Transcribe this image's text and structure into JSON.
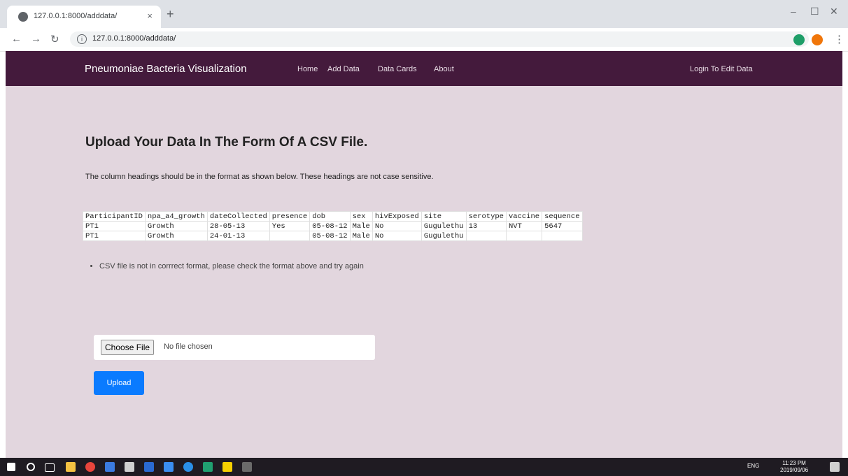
{
  "browser": {
    "tab_title": "127.0.0.1:8000/adddata/",
    "tab_close": "×",
    "new_tab": "+",
    "url": "127.0.0.1:8000/adddata/",
    "minimize": "–",
    "maximize": "☐",
    "close": "✕"
  },
  "navbar": {
    "brand": "Pneumoniae Bacteria Visualization",
    "links": [
      "Home",
      "Add Data",
      "Data Cards",
      "About"
    ],
    "login": "Login To Edit Data",
    "background": "#441a3c"
  },
  "main": {
    "heading": "Upload Your Data In The Form Of A CSV File.",
    "description": "The column headings should be in the format as shown below. These headings are not case sensitive.",
    "table": {
      "headers": [
        "ParticipantID",
        "npa_a4_growth",
        "dateCollected",
        "presence",
        "dob",
        "sex",
        "hivExposed",
        "site",
        "serotype",
        "vaccine",
        "sequence"
      ],
      "rows": [
        [
          "PT1",
          "Growth",
          "28-05-13",
          "Yes",
          "05-08-12",
          "Male",
          "No",
          "Gugulethu",
          "13",
          "NVT",
          "5647"
        ],
        [
          "PT1",
          "Growth",
          "24-01-13",
          "",
          "05-08-12",
          "Male",
          "No",
          "Gugulethu",
          "",
          "",
          ""
        ]
      ]
    },
    "error": "CSV file is not in corrrect format, please check the format above and try again",
    "file_button": "Choose File",
    "file_status": "No file chosen",
    "upload_button": "Upload",
    "background": "#e2d6de",
    "accent": "#0a7bff"
  },
  "taskbar": {
    "lang": "ENG",
    "time": "11:23 PM",
    "date": "2019/09/06"
  }
}
